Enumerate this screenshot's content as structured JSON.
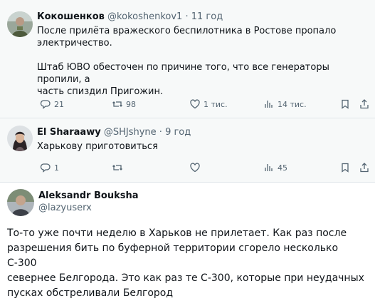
{
  "tweets": [
    {
      "author": "Кокошенков",
      "handle": "@kokoshenkov1",
      "separator": "·",
      "time": "11 год",
      "text_lines": [
        "После прилёта вражеского беспилотника в Ростове пропало",
        "электричество.",
        "",
        "Штаб ЮВО обесточен по причине того, что все генераторы пропили, а",
        "часть спиздил Пригожин."
      ],
      "replies": "21",
      "retweets": "98",
      "likes": "1 тис.",
      "views": "14 тис."
    },
    {
      "author": "El Sharaawy",
      "handle": "@SHJshyne",
      "separator": "·",
      "time": "9 год",
      "text": "Харькову приготовиться",
      "replies": "1",
      "views": "45"
    },
    {
      "author": "Aleksandr Bouksha",
      "handle": "@lazyuserx",
      "text_lines": [
        "То-то уже почти неделю в Харьков не прилетает. Как раз после",
        "разрешения бить по буферной территории сгорело несколько С-300",
        "севернее Белгорода. Это как раз те С-300, которые при неудачных",
        "пусках обстреливали Белгород"
      ]
    }
  ],
  "icons": [
    "reply-icon",
    "retweet-icon",
    "like-icon",
    "views-icon",
    "bookmark-icon",
    "share-icon"
  ],
  "colors": {
    "meta": "#536471",
    "text": "#0f1419",
    "bg_reply": "#f7f9f9",
    "divider": "#e1e6ea"
  }
}
